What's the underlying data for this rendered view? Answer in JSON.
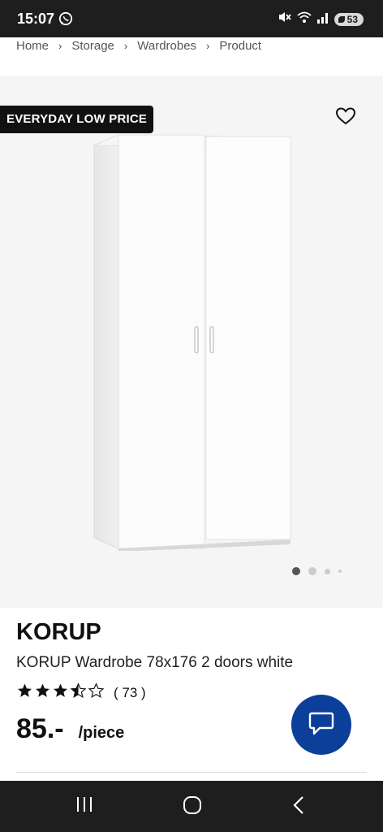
{
  "status": {
    "time": "15:07",
    "battery": "53"
  },
  "breadcrumb": [
    "Home",
    "Storage",
    "Wardrobes",
    "Product"
  ],
  "product": {
    "badge": "EVERYDAY LOW PRICE",
    "brand": "KORUP",
    "description": "KORUP Wardrobe 78x176 2 doors white",
    "rating": 3.5,
    "rating_count": "( 73 )",
    "price": "85.-",
    "unit": "/piece"
  },
  "gallery": {
    "images": 4,
    "active": 1
  },
  "colors": {
    "chat_button": "#0b3f9a",
    "badge_bg": "#111111",
    "hero_bg": "#f5f5f5"
  }
}
